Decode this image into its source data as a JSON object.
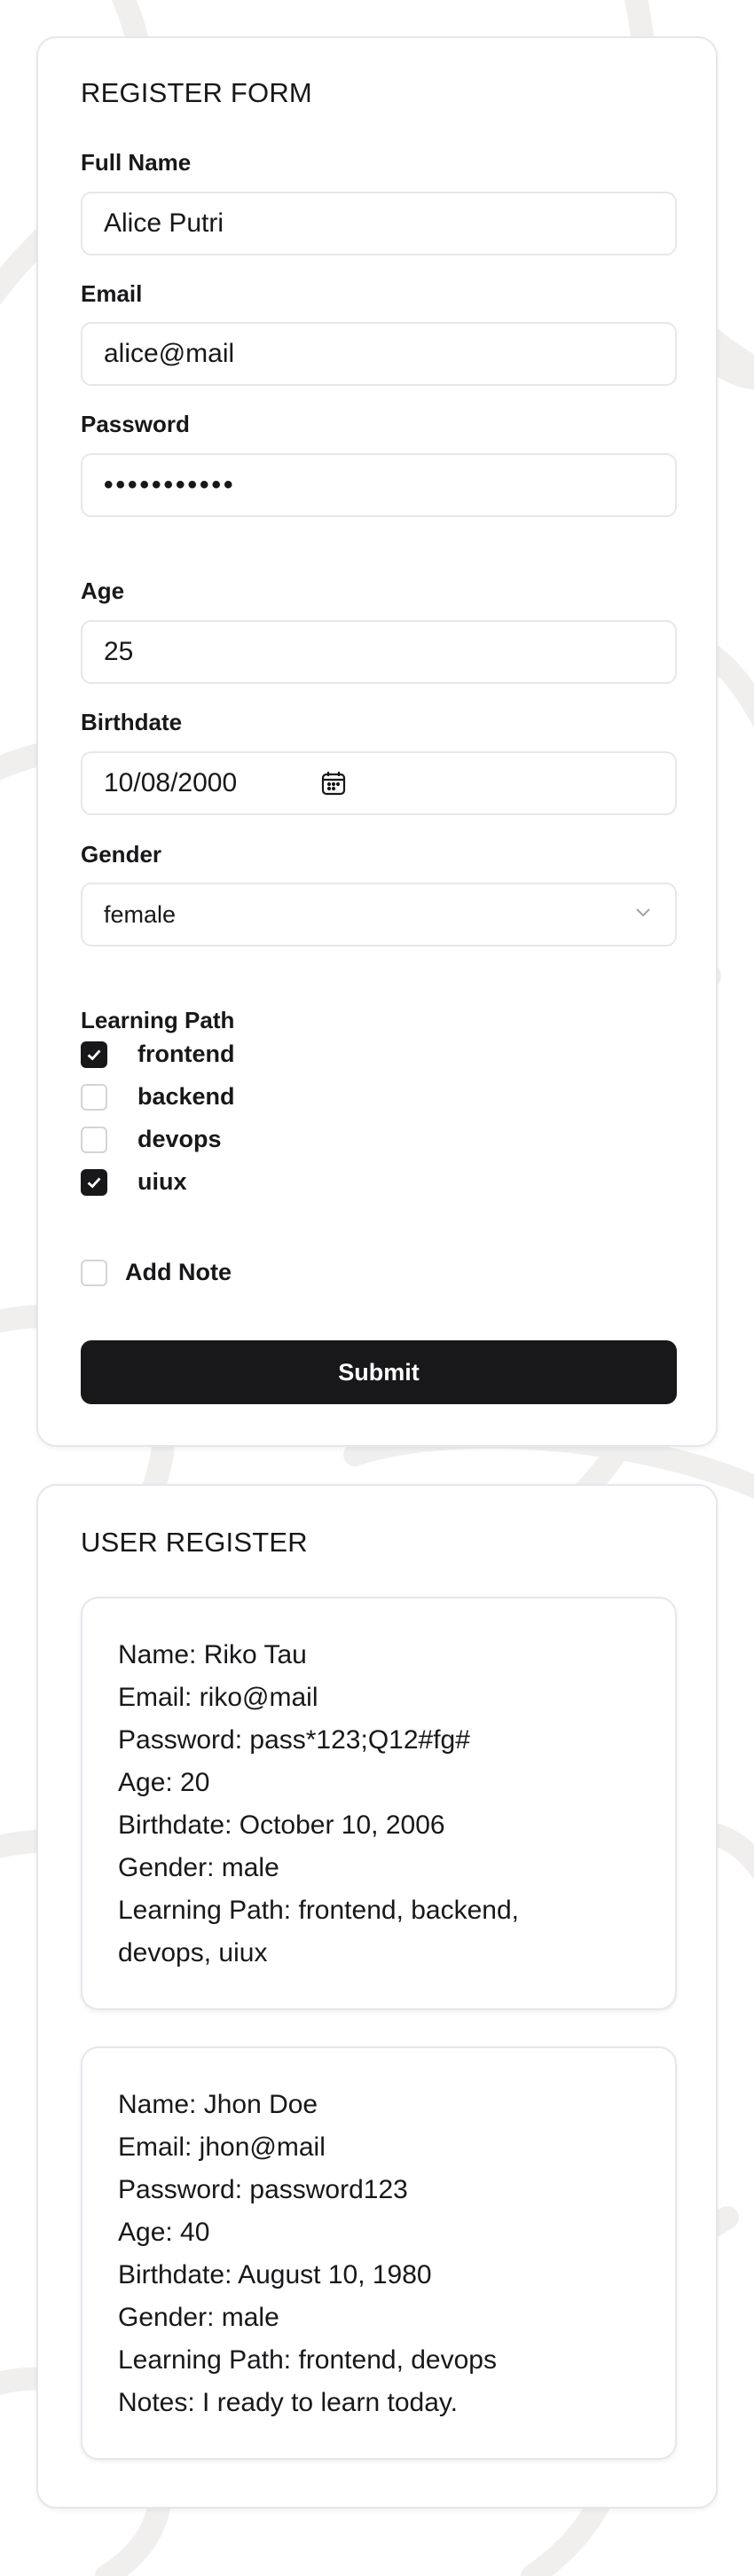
{
  "form": {
    "title": "REGISTER FORM",
    "full_name": {
      "label": "Full Name",
      "value": "Alice Putri"
    },
    "email": {
      "label": "Email",
      "value": "alice@mail"
    },
    "password": {
      "label": "Password",
      "masked": "•••••••••••"
    },
    "age": {
      "label": "Age",
      "value": "25"
    },
    "birthdate": {
      "label": "Birthdate",
      "value": "10/08/2000"
    },
    "gender": {
      "label": "Gender",
      "value": "female"
    },
    "learning_path": {
      "label": "Learning Path",
      "options": [
        {
          "label": "frontend",
          "checked": true
        },
        {
          "label": "backend",
          "checked": false
        },
        {
          "label": "devops",
          "checked": false
        },
        {
          "label": "uiux",
          "checked": true
        }
      ]
    },
    "add_note": {
      "label": "Add Note",
      "checked": false
    },
    "submit_label": "Submit"
  },
  "users": {
    "title": "USER REGISTER",
    "entries": [
      {
        "name": "Name: Riko Tau",
        "email": "Email: riko@mail",
        "password": "Password: pass*123;Q12#fg#",
        "age": "Age: 20",
        "birthdate": "Birthdate: October 10, 2006",
        "gender": "Gender: male",
        "learning_path": "Learning Path: frontend, backend, devops, uiux"
      },
      {
        "name": "Name: Jhon Doe",
        "email": "Email: jhon@mail",
        "password": "Password: password123",
        "age": "Age: 40",
        "birthdate": "Birthdate: August 10, 1980",
        "gender": "Gender: male",
        "learning_path": "Learning Path: frontend, devops",
        "notes": "Notes: I ready to learn today."
      }
    ]
  },
  "colors": {
    "accent": "#18181b",
    "border": "#e5e7eb",
    "background_pattern": "#f1eeee"
  }
}
